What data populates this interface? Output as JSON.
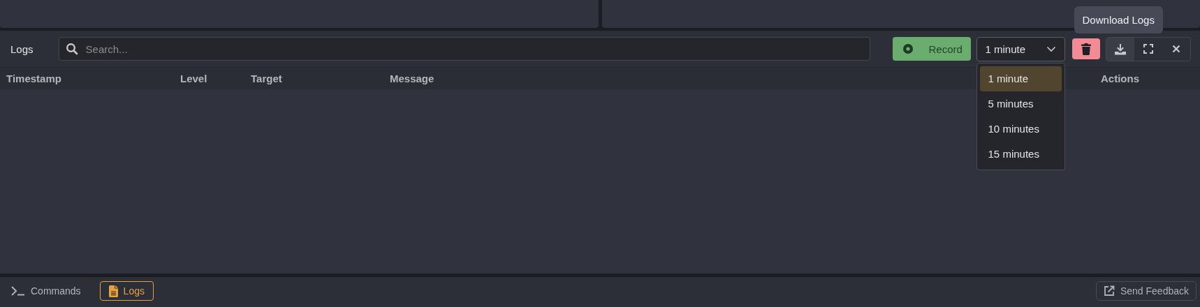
{
  "logs_panel": {
    "title": "Logs",
    "search": {
      "placeholder": "Search..."
    },
    "record_button": {
      "label": "Record"
    },
    "interval_select": {
      "value": "1 minute",
      "expanded": true,
      "options": [
        {
          "label": "1 minute",
          "selected": true
        },
        {
          "label": "5 minutes",
          "selected": false
        },
        {
          "label": "10 minutes",
          "selected": false
        },
        {
          "label": "15 minutes",
          "selected": false
        }
      ]
    },
    "actions": [
      {
        "kind": "delete",
        "hovered": false
      },
      {
        "kind": "download",
        "hovered": true
      },
      {
        "kind": "fullscreen",
        "hovered": false
      },
      {
        "kind": "close",
        "hovered": false
      }
    ],
    "tooltip": "Download Logs",
    "table": {
      "columns": [
        {
          "label": "Timestamp",
          "kind": "timestamp"
        },
        {
          "label": "Level",
          "kind": "level"
        },
        {
          "label": "Target",
          "kind": "target"
        },
        {
          "label": "Message",
          "kind": "message"
        },
        {
          "label": "Actions",
          "kind": "actions"
        }
      ]
    }
  },
  "bottom_bar": {
    "tabs": [
      {
        "label": "Commands",
        "kind": "terminal",
        "selected": false
      },
      {
        "label": "Logs",
        "kind": "file",
        "selected": true
      }
    ],
    "feedback_button": {
      "label": "Send Feedback"
    }
  }
}
